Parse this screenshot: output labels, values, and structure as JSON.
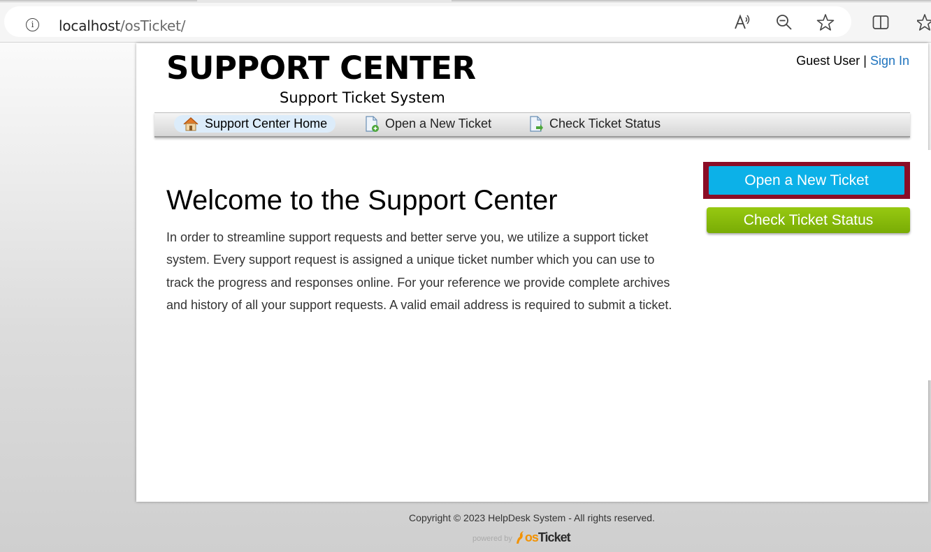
{
  "browser": {
    "url_host": "localhost",
    "url_path": "/osTicket/"
  },
  "header": {
    "title": "SUPPORT CENTER",
    "subtitle": "Support Ticket System",
    "guest_label": "Guest User |",
    "sign_in": "Sign In"
  },
  "nav": {
    "items": [
      {
        "label": "Support Center Home",
        "icon": "home-icon",
        "active": true
      },
      {
        "label": "Open a New Ticket",
        "icon": "new-ticket-icon",
        "active": false
      },
      {
        "label": "Check Ticket Status",
        "icon": "ticket-status-icon",
        "active": false
      }
    ]
  },
  "main": {
    "heading": "Welcome to the Support Center",
    "intro": "In order to streamline support requests and better serve you, we utilize a support ticket system. Every support request is assigned a unique ticket number which you can use to track the progress and responses online. For your reference we provide complete archives and history of all your support requests. A valid email address is required to submit a ticket."
  },
  "sidebar": {
    "open_ticket": "Open a New Ticket",
    "check_status": "Check Ticket Status"
  },
  "footer": {
    "copyright": "Copyright © 2023 HelpDesk System - All rights reserved.",
    "powered_by": "powered by",
    "logo_o": "os",
    "logo_rest": "Ticket"
  },
  "colors": {
    "link": "#1e73be",
    "open_button": "#0cb1e8",
    "open_button_border": "#8b0d26",
    "check_button": "#79ac05",
    "brand_orange": "#f39200"
  }
}
